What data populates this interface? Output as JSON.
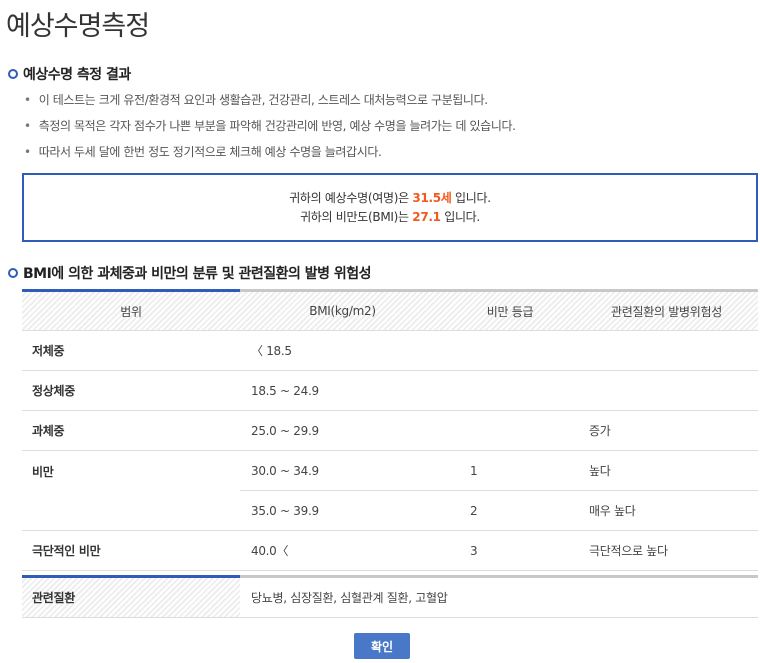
{
  "page_title": "예상수명측정",
  "section1": {
    "title": "예상수명 측정 결과",
    "bullets": [
      "이 테스트는 크게 유전/환경적 요인과 생활습관, 건강관리, 스트레스 대처능력으로 구분됩니다.",
      "측정의 목적은 각자 점수가 나쁜 부분을 파악해 건강관리에 반영, 예상 수명을 늘려가는 데 있습니다.",
      "따라서 두세 달에 한번 정도 정기적으로 체크해 예상 수명을 늘려갑시다."
    ]
  },
  "result": {
    "line1_pre": "귀하의 예상수명(여명)은 ",
    "life": "31.5세",
    "line1_post": " 입니다.",
    "line2_pre": "귀하의 비만도(BMI)는 ",
    "bmi": "27.1",
    "line2_post": " 입니다."
  },
  "section2": {
    "title": "BMI에 의한 과체중과 비만의 분류 및 관련질환의 발병 위험성",
    "headers": [
      "범위",
      "BMI(kg/m2)",
      "비만 등급",
      "관련질환의 발병위험성"
    ],
    "rows": [
      {
        "range": "저체중",
        "bmi": "〈 18.5",
        "grade": "",
        "risk": ""
      },
      {
        "range": "정상체중",
        "bmi": "18.5 ~ 24.9",
        "grade": "",
        "risk": ""
      },
      {
        "range": "과체중",
        "bmi": "25.0 ~ 29.9",
        "grade": "",
        "risk": "증가"
      },
      {
        "range": "비만",
        "bmi": "30.0 ~ 34.9",
        "grade": "1",
        "risk": "높다"
      },
      {
        "range": "",
        "bmi": "35.0 ~ 39.9",
        "grade": "2",
        "risk": "매우 높다"
      },
      {
        "range": "극단적인 비만",
        "bmi": "40.0〈",
        "grade": "3",
        "risk": "극단적으로 높다"
      }
    ],
    "disease_label": "관련질환",
    "disease_value": "당뇨병, 심장질환, 심혈관계 질환, 고혈압"
  },
  "confirm_label": "확인"
}
